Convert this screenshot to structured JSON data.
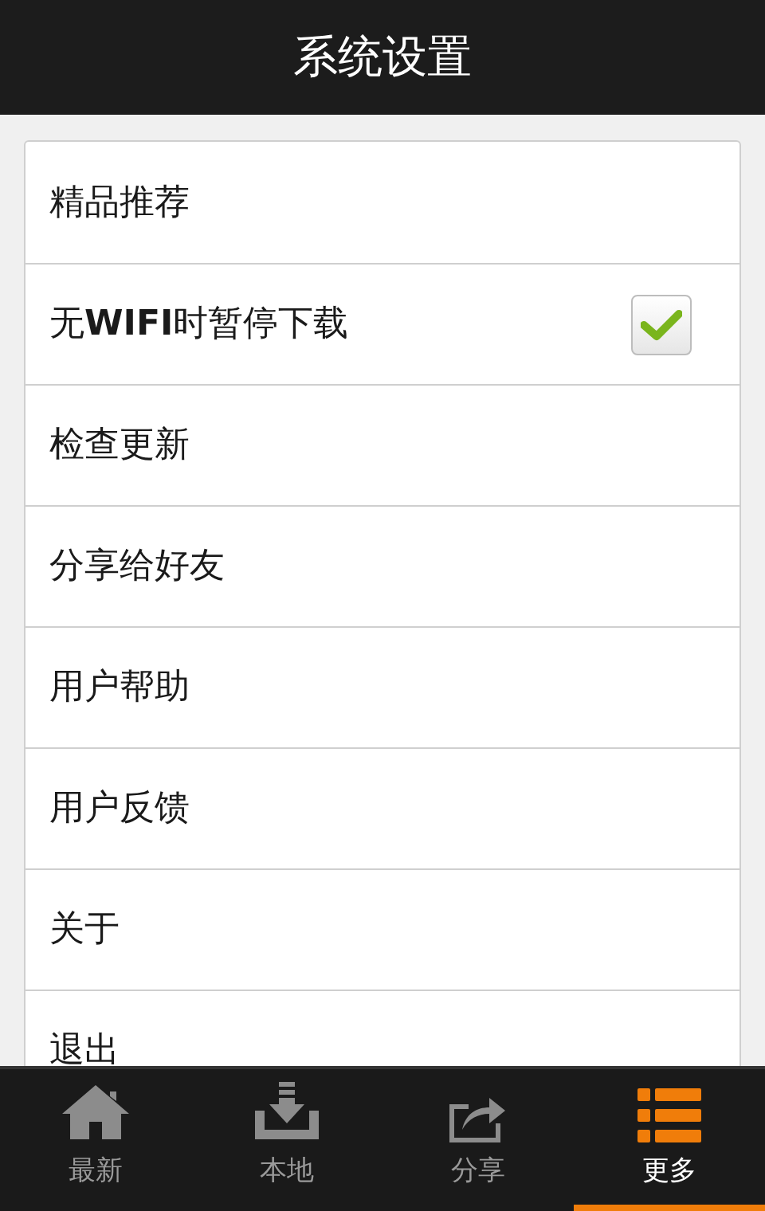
{
  "header": {
    "title": "系统设置"
  },
  "settings": [
    {
      "kind": "link",
      "label": "精品推荐"
    },
    {
      "kind": "checkbox",
      "label": "无**WIFI**时暂停下载",
      "checked": true
    },
    {
      "kind": "link",
      "label": "检查更新"
    },
    {
      "kind": "link",
      "label": "分享给好友"
    },
    {
      "kind": "link",
      "label": "用户帮助"
    },
    {
      "kind": "link",
      "label": "用户反馈"
    },
    {
      "kind": "link",
      "label": "关于"
    },
    {
      "kind": "link",
      "label": "退出"
    }
  ],
  "tabs": [
    {
      "kind": "home",
      "label": "最新",
      "selected": false
    },
    {
      "kind": "download",
      "label": "本地",
      "selected": false
    },
    {
      "kind": "share",
      "label": "分享",
      "selected": false
    },
    {
      "kind": "list",
      "label": "更多",
      "selected": true
    }
  ]
}
